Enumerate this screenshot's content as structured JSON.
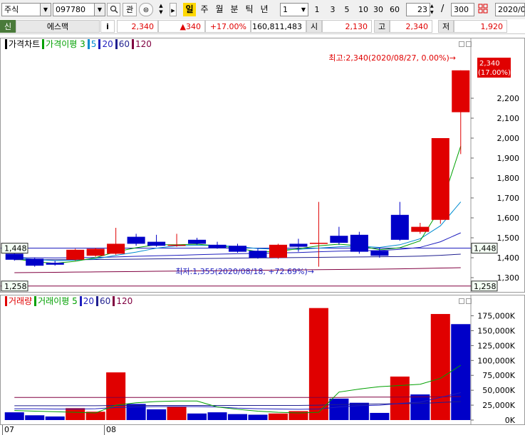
{
  "toolbar": {
    "market_type": "주식",
    "stock_code": "097780",
    "search_icon": "magnifier",
    "interest_label": "관",
    "period_tabs": [
      "일",
      "주",
      "월",
      "분",
      "틱",
      "년"
    ],
    "active_period": "일",
    "interval_value": "1",
    "quick_intervals": [
      "1",
      "3",
      "5",
      "10",
      "30",
      "60"
    ],
    "view_count": "23",
    "separator": "/",
    "total_count": "300",
    "date": "2020/0"
  },
  "quote": {
    "credit_label": "신",
    "name": "에스맥",
    "info_label": "i",
    "price": "2,340",
    "change": "▲340",
    "change_rate": "+17.00%",
    "volume": "160,811,483",
    "open_label": "시",
    "open": "2,130",
    "high_label": "고",
    "high": "2,340",
    "low_label": "저",
    "low": "1,920"
  },
  "colors": {
    "up": "#e00000",
    "down": "#0000c8",
    "ma3": "#00a000",
    "ma5": "#008bd0",
    "ma20": "#1e1ebe",
    "ma60": "#1f1f8f",
    "ma120": "#800040",
    "accent": "#ffd800"
  },
  "price_panel": {
    "legend": [
      {
        "text": "가격차트",
        "color": "#000000"
      },
      {
        "text": "가격이평 3",
        "color": "#00a000"
      },
      {
        "text": "5",
        "color": "#008bd0"
      },
      {
        "text": "20",
        "color": "#1e1ebe"
      },
      {
        "text": "60",
        "color": "#1f1f8f"
      },
      {
        "text": "120",
        "color": "#800040"
      }
    ],
    "high_annotation": "최고:2,340(2020/08/27, 0.00%)→",
    "low_annotation": "최저:1,355(2020/08/18, +72.69%)→",
    "last_price_label": "2,340",
    "last_rate_label": "(17.00%)",
    "left_markers": [
      "1,448",
      "1,258"
    ],
    "right_markers": [
      "1,448",
      "1,258"
    ]
  },
  "volume_panel": {
    "legend": [
      {
        "text": "거래량",
        "color": "#e00000"
      },
      {
        "text": "거래이평 5",
        "color": "#00a000"
      },
      {
        "text": "20",
        "color": "#1e1ebe"
      },
      {
        "text": "60",
        "color": "#1f1f8f"
      },
      {
        "text": "120",
        "color": "#800040"
      }
    ]
  },
  "x_labels": [
    "07",
    "08"
  ],
  "chart_data": [
    {
      "type": "candlestick",
      "title": "가격차트",
      "ylim": [
        1250,
        2400
      ],
      "yticks": [
        1300,
        1400,
        1500,
        1600,
        1700,
        1800,
        1900,
        2000,
        2100,
        2200
      ],
      "ytick_labels": [
        "1,300",
        "1,400",
        "1,500",
        "1,600",
        "1,700",
        "1,800",
        "1,900",
        "2,000",
        "2,100",
        "2,200"
      ],
      "reference_lines": [
        1448,
        1258
      ],
      "candles": [
        {
          "open": 1420,
          "close": 1390,
          "high": 1425,
          "low": 1385
        },
        {
          "open": 1395,
          "close": 1360,
          "high": 1400,
          "low": 1355
        },
        {
          "open": 1375,
          "close": 1365,
          "high": 1385,
          "low": 1360
        },
        {
          "open": 1390,
          "close": 1440,
          "high": 1445,
          "low": 1385
        },
        {
          "open": 1410,
          "close": 1445,
          "high": 1450,
          "low": 1405
        },
        {
          "open": 1420,
          "close": 1470,
          "high": 1550,
          "low": 1415
        },
        {
          "open": 1505,
          "close": 1470,
          "high": 1520,
          "low": 1460
        },
        {
          "open": 1480,
          "close": 1460,
          "high": 1515,
          "low": 1455
        },
        {
          "open": 1460,
          "close": 1465,
          "high": 1520,
          "low": 1455
        },
        {
          "open": 1490,
          "close": 1470,
          "high": 1500,
          "low": 1465
        },
        {
          "open": 1465,
          "close": 1450,
          "high": 1480,
          "low": 1445
        },
        {
          "open": 1460,
          "close": 1430,
          "high": 1470,
          "low": 1425
        },
        {
          "open": 1435,
          "close": 1400,
          "high": 1445,
          "low": 1395
        },
        {
          "open": 1400,
          "close": 1465,
          "high": 1470,
          "low": 1395
        },
        {
          "open": 1470,
          "close": 1455,
          "high": 1495,
          "low": 1430
        },
        {
          "open": 1475,
          "close": 1475,
          "high": 1680,
          "low": 1355
        },
        {
          "open": 1510,
          "close": 1475,
          "high": 1555,
          "low": 1465
        },
        {
          "open": 1515,
          "close": 1430,
          "high": 1530,
          "low": 1420
        },
        {
          "open": 1435,
          "close": 1410,
          "high": 1450,
          "low": 1400
        },
        {
          "open": 1615,
          "close": 1490,
          "high": 1680,
          "low": 1485
        },
        {
          "open": 1530,
          "close": 1555,
          "high": 1575,
          "low": 1520
        },
        {
          "open": 1590,
          "close": 2000,
          "high": 2000,
          "low": 1570
        },
        {
          "open": 2130,
          "close": 2340,
          "high": 2340,
          "low": 1920
        }
      ],
      "ma3": [
        1395,
        1380,
        1372,
        1382,
        1400,
        1430,
        1450,
        1465,
        1465,
        1468,
        1460,
        1448,
        1430,
        1432,
        1445,
        1460,
        1468,
        1460,
        1440,
        1450,
        1485,
        1650,
        1960
      ],
      "ma5": [
        1400,
        1392,
        1385,
        1388,
        1394,
        1412,
        1428,
        1448,
        1460,
        1462,
        1462,
        1456,
        1446,
        1442,
        1442,
        1448,
        1455,
        1458,
        1452,
        1465,
        1495,
        1560,
        1680
      ],
      "ma20": [
        1400,
        1400,
        1399,
        1400,
        1401,
        1404,
        1407,
        1410,
        1412,
        1415,
        1418,
        1420,
        1422,
        1424,
        1426,
        1430,
        1433,
        1435,
        1436,
        1442,
        1452,
        1480,
        1525
      ],
      "ma60": [
        1390,
        1390,
        1390,
        1390,
        1391,
        1392,
        1393,
        1394,
        1395,
        1396,
        1397,
        1398,
        1399,
        1400,
        1401,
        1402,
        1403,
        1404,
        1405,
        1406,
        1408,
        1412,
        1418
      ],
      "ma120": [
        1325,
        1326,
        1327,
        1328,
        1329,
        1330,
        1331,
        1332,
        1333,
        1334,
        1335,
        1336,
        1337,
        1338,
        1339,
        1340,
        1341,
        1342,
        1343,
        1344,
        1346,
        1348,
        1350
      ]
    },
    {
      "type": "bar",
      "title": "거래량",
      "ylim": [
        0,
        190000
      ],
      "yticks": [
        0,
        25000,
        50000,
        75000,
        100000,
        125000,
        150000,
        175000
      ],
      "ytick_labels": [
        "0K",
        "25,000K",
        "50,000K",
        "75,000K",
        "100,000K",
        "125,000K",
        "150,000K",
        "175,000K"
      ],
      "values": [
        13000,
        8000,
        6000,
        20000,
        14000,
        80000,
        27000,
        18000,
        22000,
        11000,
        13000,
        10000,
        9000,
        11000,
        15000,
        188000,
        36000,
        29000,
        12000,
        73000,
        43000,
        178000,
        161000
      ],
      "up": [
        false,
        false,
        false,
        true,
        true,
        true,
        false,
        false,
        true,
        false,
        false,
        false,
        false,
        true,
        true,
        true,
        false,
        false,
        false,
        true,
        false,
        true,
        false
      ],
      "ma5": [
        16000,
        15000,
        14000,
        13000,
        12000,
        25000,
        29000,
        31000,
        32000,
        32000,
        22000,
        18000,
        15000,
        13000,
        12000,
        13000,
        47000,
        52000,
        56000,
        58000,
        60000,
        70000,
        92000
      ],
      "ma20": [
        19000,
        19000,
        18500,
        18500,
        19000,
        21000,
        22000,
        22500,
        22500,
        22500,
        22000,
        20000,
        19000,
        18500,
        18000,
        18500,
        22000,
        24000,
        25000,
        28000,
        30000,
        38000,
        46000
      ],
      "ma60": [
        24000,
        24000,
        24000,
        24000,
        24000,
        24500,
        24500,
        24500,
        24500,
        24500,
        24500,
        24500,
        24500,
        24500,
        24500,
        25000,
        26000,
        26500,
        27000,
        27500,
        28000,
        29500,
        31000
      ],
      "ma120": [
        38000,
        38000,
        38000,
        38000,
        38000,
        38000,
        38000,
        38000,
        38000,
        38000,
        38000,
        38000,
        38000,
        38000,
        38000,
        38000,
        38000,
        38500,
        38500,
        38500,
        39000,
        39000,
        39500
      ]
    }
  ]
}
